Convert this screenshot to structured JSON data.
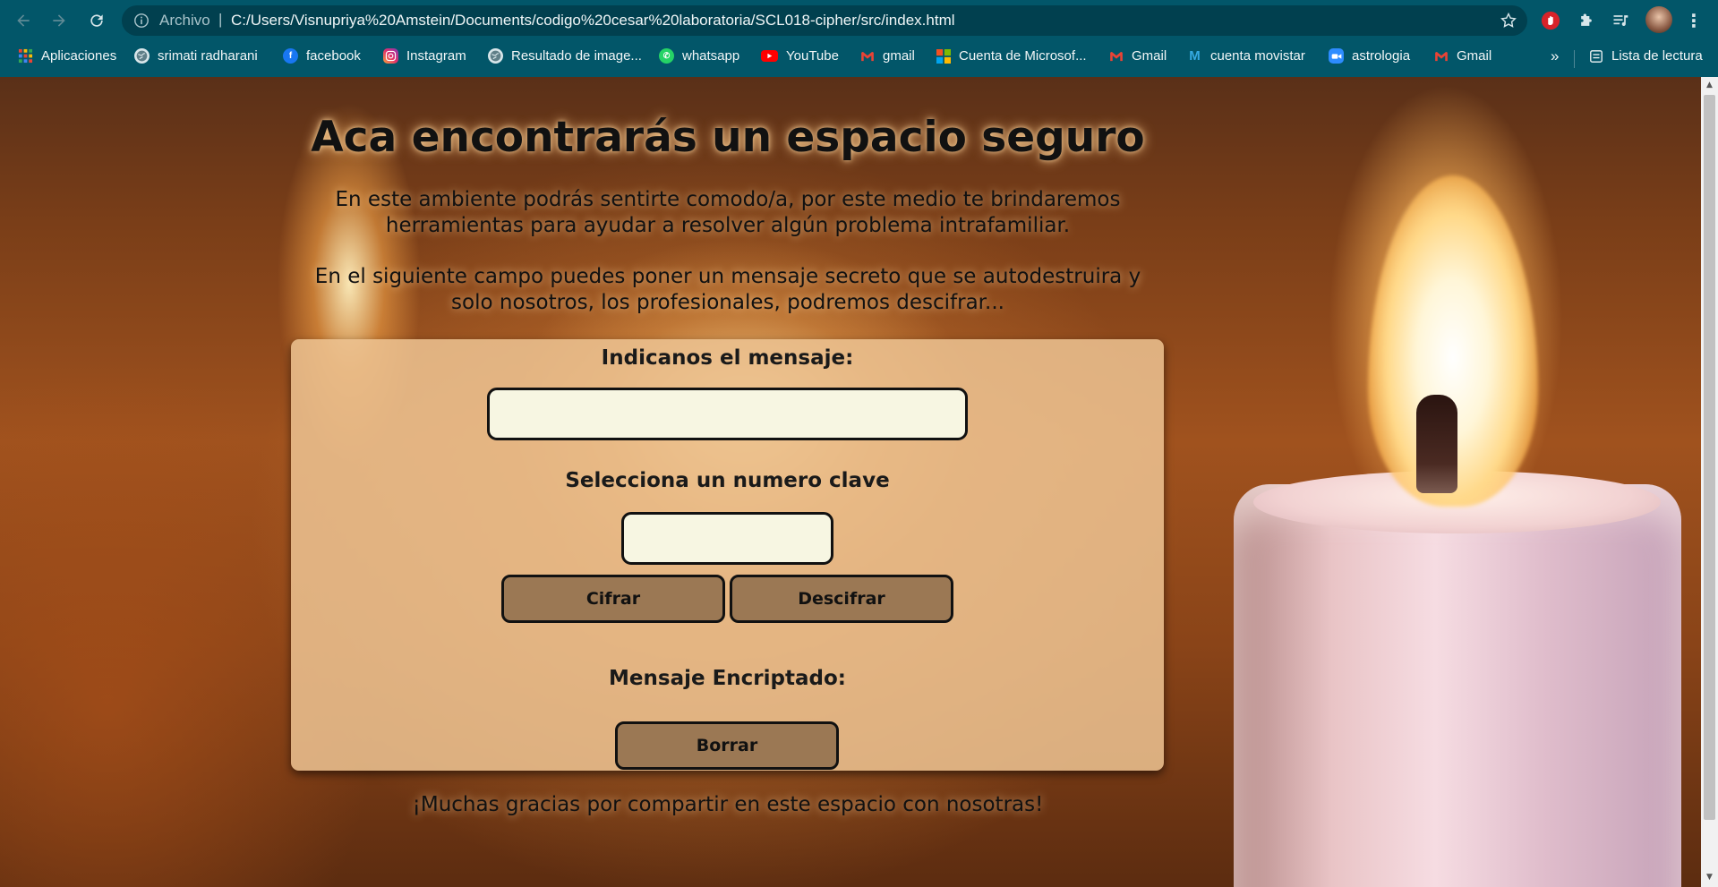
{
  "browser": {
    "scheme_label": "Archivo",
    "separator": "|",
    "url": "C:/Users/Visnupriya%20Amstein/Documents/codigo%20cesar%20laboratoria/SCL018-cipher/src/index.html",
    "bookmarks": [
      {
        "label": "Aplicaciones",
        "icon": "apps-grid-icon"
      },
      {
        "label": "srimati radharani",
        "icon": "globe-icon"
      },
      {
        "label": "facebook",
        "icon": "facebook-icon"
      },
      {
        "label": "Instagram",
        "icon": "instagram-icon"
      },
      {
        "label": "Resultado de image...",
        "icon": "globe-icon"
      },
      {
        "label": "whatsapp",
        "icon": "whatsapp-icon"
      },
      {
        "label": "YouTube",
        "icon": "youtube-icon"
      },
      {
        "label": "gmail",
        "icon": "gmail-icon"
      },
      {
        "label": "Cuenta de Microsof...",
        "icon": "microsoft-icon"
      },
      {
        "label": "Gmail",
        "icon": "gmail-icon"
      },
      {
        "label": "cuenta movistar",
        "icon": "movistar-icon"
      },
      {
        "label": "astrologia",
        "icon": "zoom-icon"
      },
      {
        "label": "Gmail",
        "icon": "gmail-icon"
      }
    ],
    "more_bookmarks": "»",
    "reading_list": "Lista de lectura",
    "colors": {
      "chrome": "#025669",
      "omnibox": "#01404f"
    }
  },
  "page": {
    "title": "Aca encontrarás un espacio seguro",
    "intro_1": "En este ambiente podrás sentirte comodo/a, por este medio te brindaremos herramientas para ayudar a resolver algún problema intrafamiliar.",
    "intro_2": "En el siguiente campo puedes poner un mensaje secreto que se autodestruira y solo nosotros, los profesionales, podremos descifrar...",
    "form": {
      "message_label": "Indicanos el mensaje:",
      "message_value": "",
      "key_label": "Selecciona un numero clave",
      "key_value": "",
      "cipher_button": "Cifrar",
      "decipher_button": "Descifrar",
      "output_label": "Mensaje Encriptado:",
      "clear_button": "Borrar"
    },
    "footer": "¡Muchas gracias por compartir en este espacio con nosotras!",
    "colors": {
      "card": "#ecc391",
      "button": "#9b7854",
      "input": "#f7f6e2"
    }
  }
}
